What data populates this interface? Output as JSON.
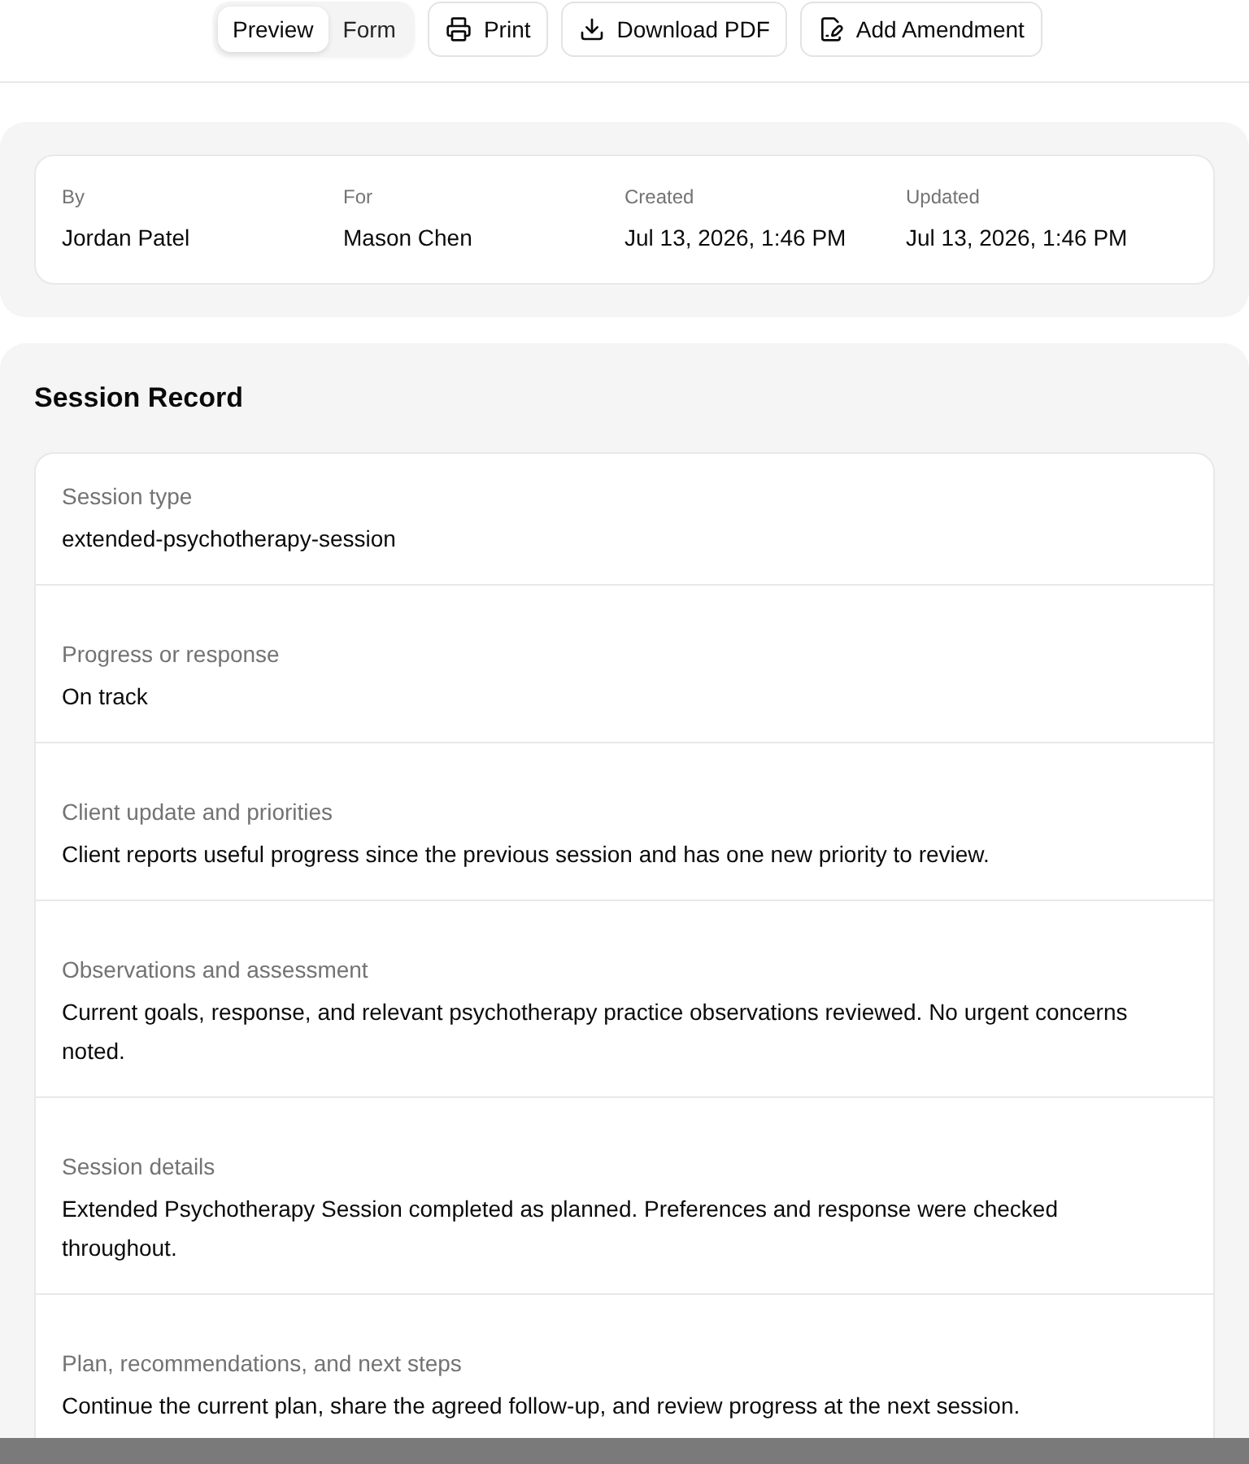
{
  "toolbar": {
    "view_tabs": [
      {
        "label": "Preview",
        "selected": true
      },
      {
        "label": "Form",
        "selected": false
      }
    ],
    "actions": [
      {
        "label": "Print",
        "kind": "print"
      },
      {
        "label": "Download PDF",
        "kind": "download"
      },
      {
        "label": "Add Amendment",
        "kind": "amend"
      }
    ]
  },
  "meta": [
    {
      "label": "By",
      "value": "Jordan Patel"
    },
    {
      "label": "For",
      "value": "Mason Chen"
    },
    {
      "label": "Created",
      "value": "Jul 13, 2026, 1:46 PM"
    },
    {
      "label": "Updated",
      "value": "Jul 13, 2026, 1:46 PM"
    }
  ],
  "record": {
    "title": "Session Record",
    "fields": [
      {
        "label": "Session type",
        "value": "extended-psychotherapy-session"
      },
      {
        "label": "Progress or response",
        "value": "On track"
      },
      {
        "label": "Client update and priorities",
        "value": "Client reports useful progress since the previous session and has one new priority to review."
      },
      {
        "label": "Observations and assessment",
        "value": "Current goals, response, and relevant psychotherapy practice observations reviewed. No urgent concerns noted."
      },
      {
        "label": "Session details",
        "value": "Extended Psychotherapy Session completed as planned. Preferences and response were checked throughout."
      },
      {
        "label": "Plan, recommendations, and next steps",
        "value": "Continue the current plan, share the agreed follow-up, and review progress at the next session."
      }
    ]
  }
}
